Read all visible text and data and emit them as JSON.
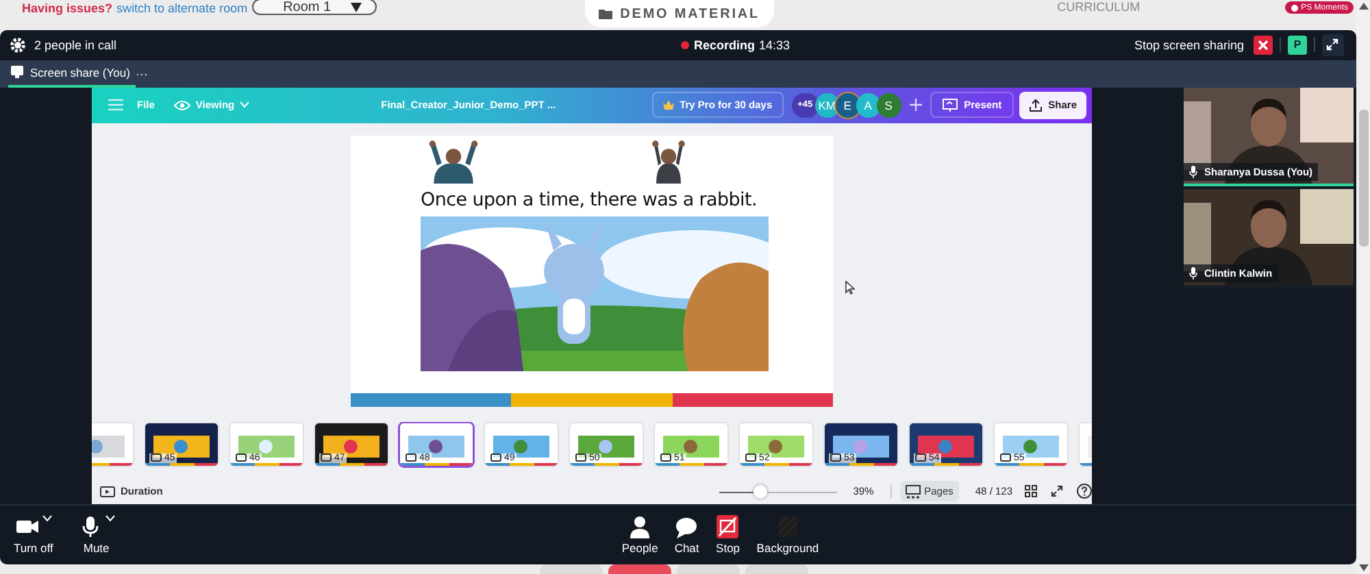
{
  "top_bar": {
    "issue_text": "Having issues?",
    "switch_link": "switch to alternate room",
    "room_select": "Room 1",
    "demo_material": "DEMO MATERIAL",
    "curriculum": "CURRICULUM",
    "moments_badge": "PS Moments"
  },
  "call_header": {
    "people_count": "2 people in call",
    "recording": "Recording",
    "recording_time": "14:33",
    "stop_sharing": "Stop screen sharing",
    "avatar_letter": "P"
  },
  "tabs": [
    {
      "label": "Screen share (You)",
      "selected": true
    }
  ],
  "tab_more": "···",
  "editor": {
    "menu": "File",
    "mode": "Viewing",
    "document_title": "Final_Creator_Junior_Demo_PPT ...",
    "pro_button": "Try Pro for 30 days",
    "collaborators_more": "+45",
    "collaborators": [
      {
        "initials": "KM",
        "color": "#1fb8c4"
      },
      {
        "initials": "E",
        "color": "#1a5f8a"
      },
      {
        "initials": "A",
        "color": "#22bccb"
      },
      {
        "initials": "S",
        "color": "#2e7d32"
      }
    ],
    "present": "Present",
    "share": "Share"
  },
  "slide": {
    "caption": "Once upon a time, there was a rabbit."
  },
  "filmstrip": [
    {
      "selected": false
    },
    {
      "number": "45",
      "selected": false
    },
    {
      "number": "46",
      "selected": false
    },
    {
      "number": "47",
      "selected": false
    },
    {
      "number": "48",
      "selected": true
    },
    {
      "number": "49",
      "selected": false
    },
    {
      "number": "50",
      "selected": false
    },
    {
      "number": "51",
      "selected": false
    },
    {
      "number": "52",
      "selected": false
    },
    {
      "number": "53",
      "selected": false
    },
    {
      "number": "54",
      "selected": false
    },
    {
      "number": "55",
      "selected": false
    },
    {
      "selected": false
    }
  ],
  "footer": {
    "duration": "Duration",
    "zoom": {
      "level": 0.35
    },
    "zoom_reading": "39%",
    "pages": "Pages",
    "page_counter": "48 / 123"
  },
  "participants": [
    {
      "name": "Sharanya Dussa (You)",
      "speaking": true
    },
    {
      "name": "Clintin Kalwin",
      "speaking": false
    }
  ],
  "bottom_tabs": [
    {
      "selected": false
    },
    {
      "selected": true
    },
    {
      "selected": false
    },
    {
      "selected": false
    }
  ],
  "controls": [
    {
      "label": "Turn off",
      "kind": "camera",
      "dropdown": true
    },
    {
      "label": "Mute",
      "kind": "mic",
      "dropdown": true
    },
    {
      "label": "People",
      "kind": "people",
      "dropdown": false
    },
    {
      "label": "Chat",
      "kind": "chat",
      "dropdown": false
    },
    {
      "label": "Stop",
      "kind": "stop",
      "dropdown": false
    },
    {
      "label": "Background",
      "kind": "background",
      "dropdown": false
    }
  ]
}
